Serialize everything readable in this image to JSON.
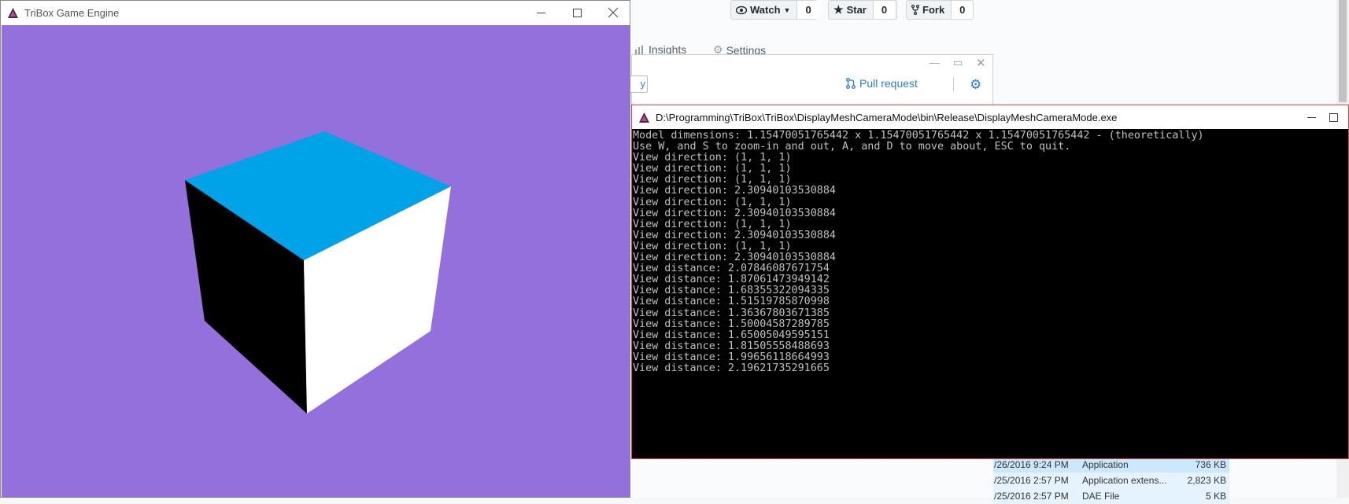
{
  "github": {
    "watch_label": "Watch",
    "watch_count": "0",
    "star_label": "Star",
    "star_count": "0",
    "fork_label": "Fork",
    "fork_count": "0",
    "tab_insights": "Insights",
    "tab_settings": "Settings"
  },
  "gh_desktop": {
    "pull_request_label": "Pull request",
    "partial_button_text": "y"
  },
  "file_list": [
    {
      "date": "/26/2016 9:24 PM",
      "type": "Application",
      "size": "736 KB"
    },
    {
      "date": "/25/2016 2:57 PM",
      "type": "Application extens...",
      "size": "2,823 KB"
    },
    {
      "date": "/25/2016 2:57 PM",
      "type": "DAE File",
      "size": "5 KB"
    }
  ],
  "tribox": {
    "title": "TriBox Game Engine",
    "canvas_color": "#9370db",
    "cube_top_color": "#00a2e8",
    "cube_left_color": "#000000",
    "cube_right_color": "#ffffff"
  },
  "console": {
    "title": "D:\\Programming\\TriBox\\TriBox\\DisplayMeshCameraMode\\bin\\Release\\DisplayMeshCameraMode.exe",
    "lines": [
      "Model dimensions: 1.15470051765442 x 1.15470051765442 x 1.15470051765442 - (theoretically)",
      "Use W, and S to zoom-in and out, A, and D to move about, ESC to quit.",
      "View direction: (1, 1, 1)",
      "View direction: (1, 1, 1)",
      "View direction: (1, 1, 1)",
      "View direction: 2.30940103530884",
      "View direction: (1, 1, 1)",
      "View direction: 2.30940103530884",
      "View direction: (1, 1, 1)",
      "View direction: 2.30940103530884",
      "View direction: (1, 1, 1)",
      "View direction: 2.30940103530884",
      "View distance: 2.07846087671754",
      "View distance: 1.87061473949142",
      "View distance: 1.68355322094335",
      "View distance: 1.51519785870998",
      "View distance: 1.36367803671385",
      "View distance: 1.50004587289785",
      "View distance: 1.65005049595151",
      "View distance: 1.81505558488693",
      "View distance: 1.99656118664993",
      "View distance: 2.19621735291665"
    ]
  },
  "icons": {
    "minimize": "minimize-icon",
    "maximize": "maximize-icon",
    "close": "close-icon"
  }
}
